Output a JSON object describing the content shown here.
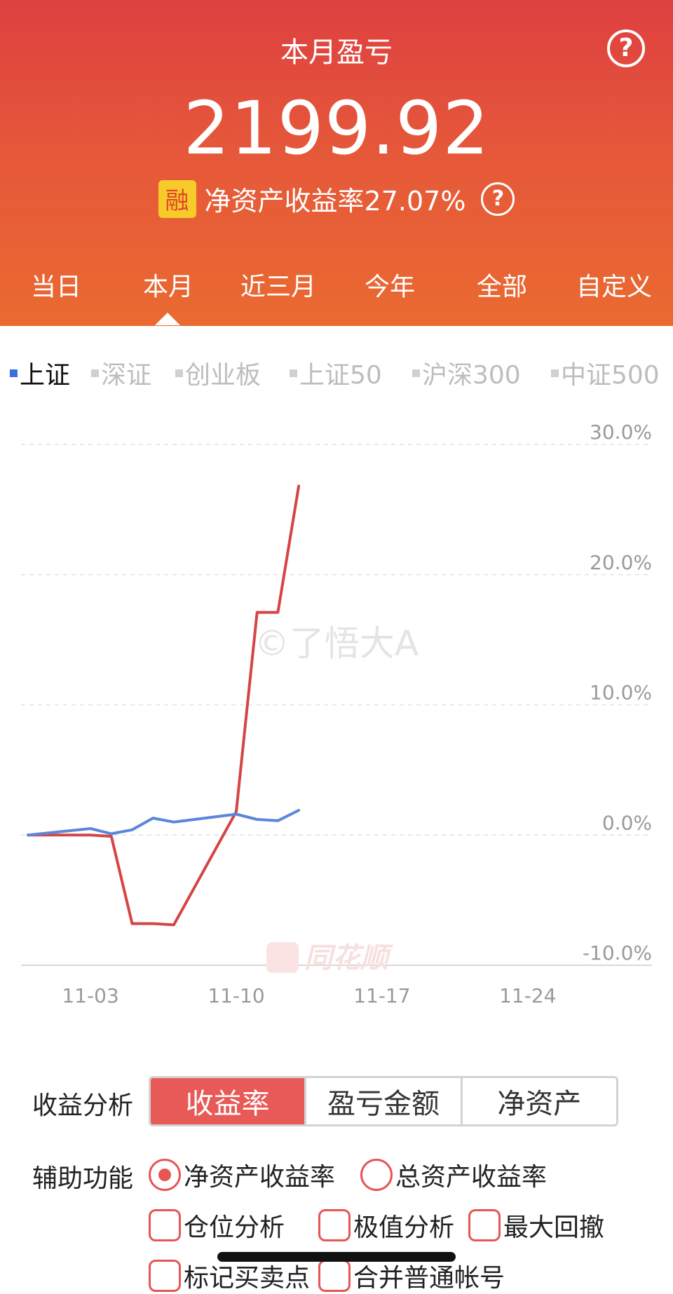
{
  "header": {
    "title": "本月盈亏",
    "amount": "2199.92",
    "rong_badge": "融",
    "roe_text": "净资产收益率27.07%",
    "help_glyph": "?",
    "help_icon": "question-circle-icon"
  },
  "period_tabs": [
    {
      "label": "当日",
      "active": false
    },
    {
      "label": "本月",
      "active": true
    },
    {
      "label": "近三月",
      "active": false
    },
    {
      "label": "今年",
      "active": false
    },
    {
      "label": "全部",
      "active": false
    },
    {
      "label": "自定义",
      "active": false
    }
  ],
  "index_tabs": [
    {
      "label": "上证",
      "active": true
    },
    {
      "label": "深证",
      "active": false
    },
    {
      "label": "创业板",
      "active": false
    },
    {
      "label": "上证50",
      "active": false
    },
    {
      "label": "沪深300",
      "active": false
    },
    {
      "label": "中证500",
      "active": false
    }
  ],
  "watermarks": {
    "author": "©了悟大A",
    "brand": "同花顺"
  },
  "chart_data": {
    "type": "line",
    "x_ticks": [
      "11-03",
      "11-10",
      "11-17",
      "11-24"
    ],
    "y_ticks": [
      "30.0%",
      "20.0%",
      "10.0%",
      "0.0%",
      "-10.0%"
    ],
    "ylim": [
      -10,
      30
    ],
    "unit": "%",
    "grid": true,
    "series": [
      {
        "color": "#d64545",
        "points": [
          [
            0,
            0
          ],
          [
            1,
            0
          ],
          [
            2,
            0
          ],
          [
            3,
            0
          ],
          [
            4,
            -0.1
          ],
          [
            5,
            -6.8
          ],
          [
            6,
            -6.8
          ],
          [
            7,
            -6.9
          ],
          [
            10,
            1.8
          ],
          [
            11,
            17.1
          ],
          [
            12,
            17.1
          ],
          [
            13,
            26.8
          ]
        ]
      },
      {
        "color": "#5b86d9",
        "points": [
          [
            0,
            0
          ],
          [
            3,
            0.5
          ],
          [
            4,
            0.1
          ],
          [
            5,
            0.4
          ],
          [
            6,
            1.3
          ],
          [
            7,
            1.0
          ],
          [
            10,
            1.6
          ],
          [
            11,
            1.2
          ],
          [
            12,
            1.1
          ],
          [
            13,
            1.9
          ]
        ]
      }
    ]
  },
  "analysis": {
    "label": "收益分析",
    "segments": [
      {
        "label": "收益率",
        "active": true
      },
      {
        "label": "盈亏金额",
        "active": false
      },
      {
        "label": "净资产",
        "active": false
      }
    ]
  },
  "aux": {
    "label": "辅助功能",
    "radios": [
      {
        "label": "净资产收益率",
        "checked": true
      },
      {
        "label": "总资产收益率",
        "checked": false
      }
    ],
    "checkboxes": [
      {
        "label": "仓位分析",
        "checked": false
      },
      {
        "label": "极值分析",
        "checked": false
      },
      {
        "label": "最大回撤",
        "checked": false
      },
      {
        "label": "标记买卖点",
        "checked": false
      },
      {
        "label": "合并普通帐号",
        "checked": false
      }
    ]
  },
  "colors": {
    "header_top": "#de4040",
    "header_bottom": "#ea6a30",
    "accent": "#e85a57",
    "index_active": "#3b6fe0"
  }
}
